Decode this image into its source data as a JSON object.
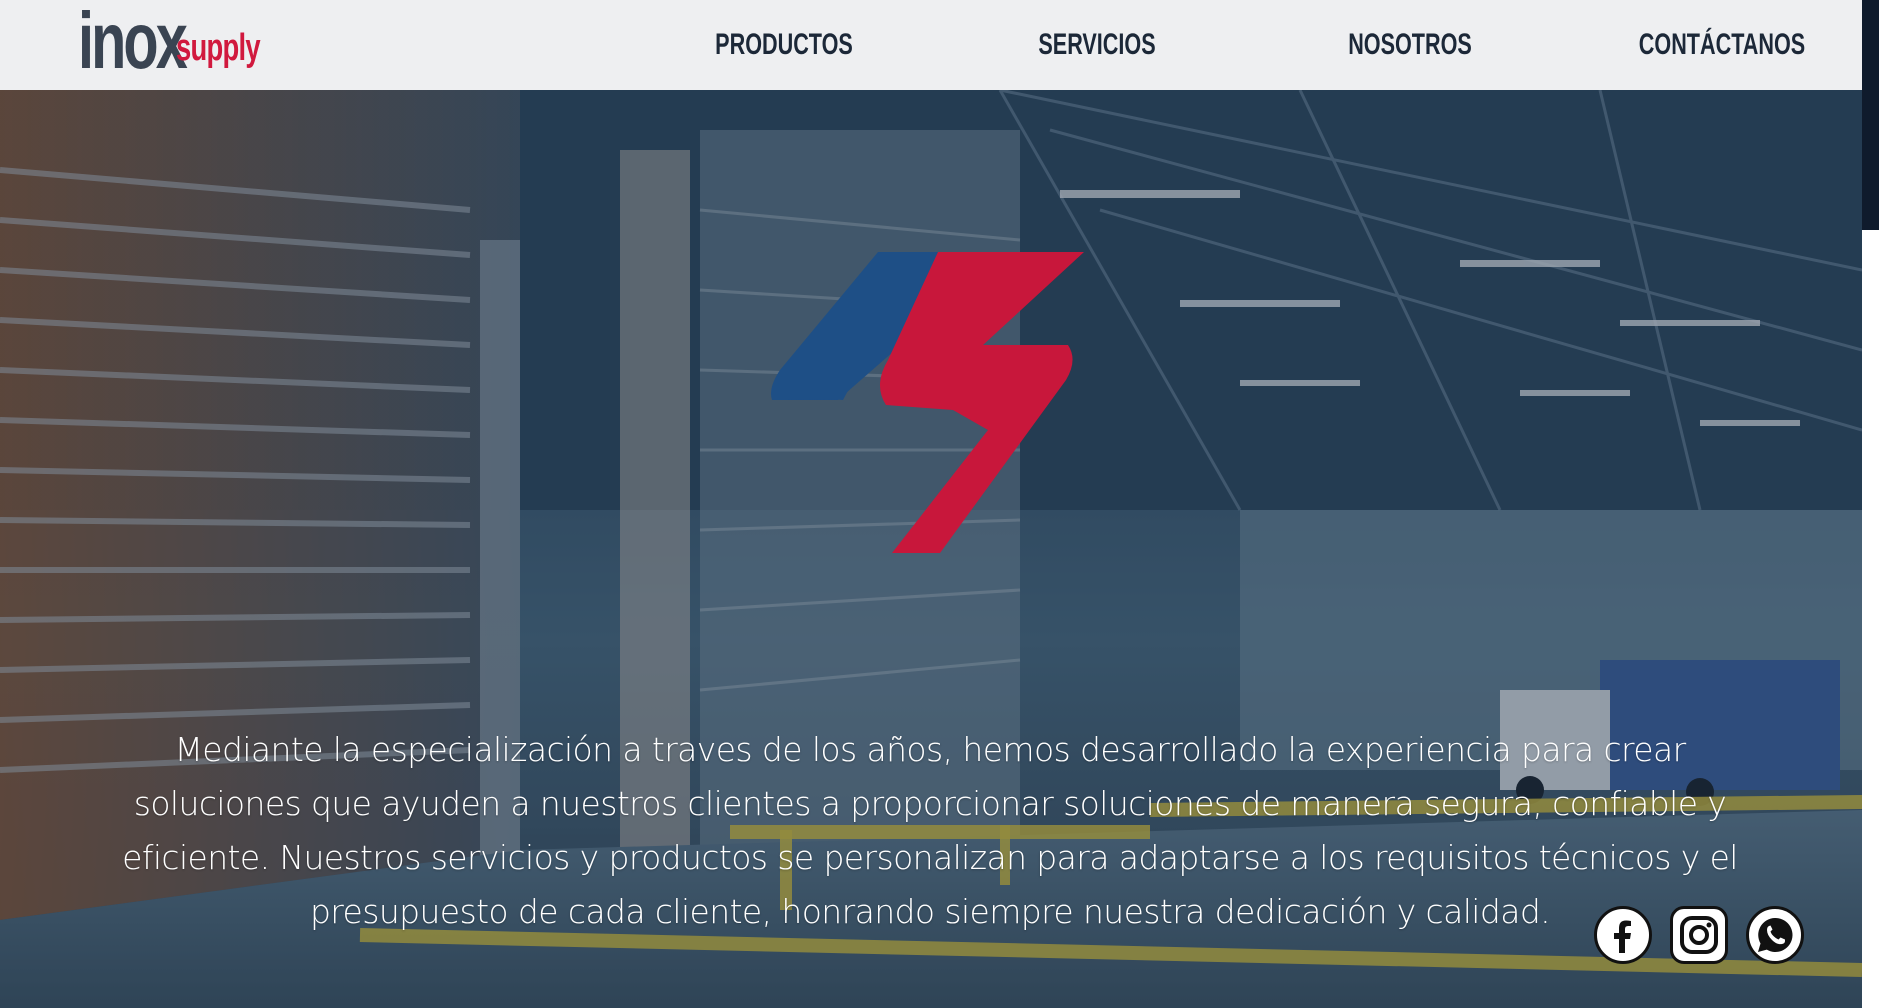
{
  "brand": {
    "logo_main": "inox",
    "logo_sub": "supply",
    "logo_main_color": "#3a4452",
    "logo_sub_color": "#d1193e"
  },
  "nav": {
    "items": [
      {
        "label": "PRODUCTOS"
      },
      {
        "label": "SERVICIOS"
      },
      {
        "label": "NOSOTROS"
      },
      {
        "label": "CONTÁCTANOS"
      }
    ]
  },
  "hero": {
    "mark_colors": {
      "blue": "#1e4f86",
      "red": "#c8173b"
    },
    "paragraph": "Mediante la especialización a traves de los años, hemos desarrollado la experiencia para crear soluciones que ayuden a nuestros clientes a proporcionar soluciones de manera segura, confiable y eficiente. Nuestros servicios y productos se personalizan para adaptarse a los requisitos técnicos y el presupuesto de cada cliente, honrando siempre nuestra dedicación y calidad."
  },
  "social": [
    {
      "name": "facebook",
      "icon": "facebook-icon"
    },
    {
      "name": "instagram",
      "icon": "instagram-icon"
    },
    {
      "name": "whatsapp",
      "icon": "whatsapp-icon"
    }
  ]
}
